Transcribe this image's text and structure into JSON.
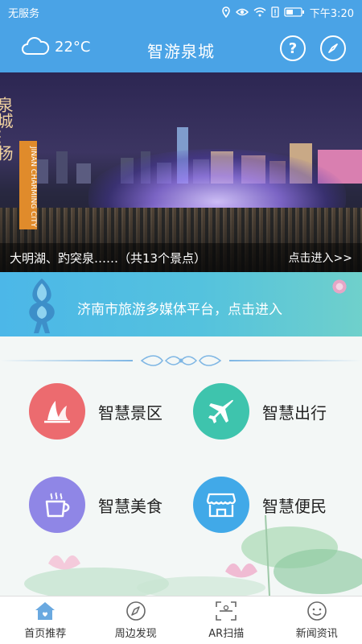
{
  "status_bar": {
    "carrier": "无服务",
    "time": "下午3:20",
    "icons": [
      "location-icon",
      "eye-icon",
      "wifi-icon",
      "alert-icon",
      "battery-icon"
    ]
  },
  "header": {
    "weather_icon": "cloud-icon",
    "temperature": "22°C",
    "title": "智游泉城",
    "help_icon": "question-icon",
    "help_label": "?",
    "compass_icon": "compass-icon",
    "background": "#4aa3e6"
  },
  "banner": {
    "side_text": "泉城…扬",
    "badge_text": "JINAN CHARMING CITY",
    "caption": "大明湖、趵突泉……（共13个景点）",
    "enter_link": "点击进入>>"
  },
  "platform": {
    "text": "济南市旅游多媒体平台，点击进入"
  },
  "services": [
    {
      "label": "智慧景区",
      "icon": "sail-icon",
      "color": "#ec6b6f"
    },
    {
      "label": "智慧出行",
      "icon": "airplane-icon",
      "color": "#3ec4ad"
    },
    {
      "label": "智慧美食",
      "icon": "coffee-icon",
      "color": "#8f86e6"
    },
    {
      "label": "智慧便民",
      "icon": "shop-icon",
      "color": "#41a9e8"
    }
  ],
  "tabbar": {
    "items": [
      {
        "label": "首页推荐",
        "icon": "home-icon",
        "active": true
      },
      {
        "label": "周边发现",
        "icon": "compass-nav-icon",
        "active": false
      },
      {
        "label": "AR扫描",
        "icon": "ar-scan-icon",
        "active": false
      },
      {
        "label": "新闻资讯",
        "icon": "smiley-icon",
        "active": false
      }
    ]
  }
}
